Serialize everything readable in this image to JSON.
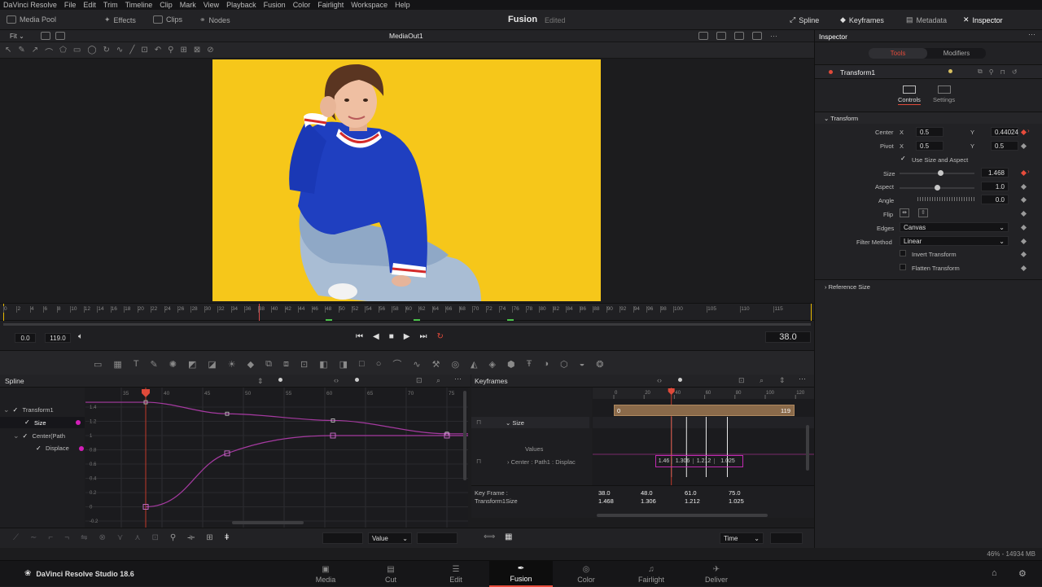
{
  "menubar": {
    "items": [
      "DaVinci Resolve",
      "File",
      "Edit",
      "Trim",
      "Timeline",
      "Clip",
      "Mark",
      "View",
      "Playback",
      "Fusion",
      "Color",
      "Fairlight",
      "Workspace",
      "Help"
    ]
  },
  "toolbar": {
    "media_pool": "Media Pool",
    "effects": "Effects",
    "clips": "Clips",
    "nodes": "Nodes",
    "title": "Fusion",
    "edited": "Edited",
    "spline": "Spline",
    "keyframes": "Keyframes",
    "metadata": "Metadata",
    "inspector": "Inspector"
  },
  "viewer": {
    "fit": "Fit",
    "name": "MediaOut1"
  },
  "ruler": {
    "ticks": [
      "0",
      "2",
      "4",
      "6",
      "8",
      "10",
      "12",
      "14",
      "16",
      "18",
      "20",
      "22",
      "24",
      "26",
      "28",
      "30",
      "32",
      "34",
      "36",
      "38",
      "40",
      "42",
      "44",
      "46",
      "48",
      "50",
      "52",
      "54",
      "56",
      "58",
      "60",
      "62",
      "64",
      "66",
      "68",
      "70",
      "72",
      "74",
      "76",
      "78",
      "80",
      "82",
      "84",
      "86",
      "88",
      "90",
      "92",
      "94",
      "96",
      "98",
      "100",
      "105",
      "110",
      "115"
    ]
  },
  "transport": {
    "start": "0.0",
    "end": "119.0",
    "current": "38.0"
  },
  "spline": {
    "title": "Spline",
    "tree": [
      {
        "label": "Transform1",
        "level": 0
      },
      {
        "label": "Size",
        "level": 1
      },
      {
        "label": "Center(Path",
        "level": 1
      },
      {
        "label": "Displace",
        "level": 2
      }
    ],
    "x_ticks": [
      "35",
      "40",
      "45",
      "50",
      "55",
      "60",
      "65",
      "70",
      "75"
    ],
    "y_ticks": [
      "1.4",
      "1.2",
      "1",
      "0.8",
      "0.6",
      "0.4",
      "0.2",
      "0",
      "-0.2"
    ],
    "value_label": "Value"
  },
  "keyframes": {
    "title": "Keyframes",
    "ticks": [
      "0",
      "20",
      "40",
      "60",
      "80",
      "100",
      "120"
    ],
    "size_label": "Size",
    "values_label": "Values",
    "center_label": "Center : Path1 : Displac",
    "range_start": "0",
    "range_end": "119",
    "key_values": [
      "1.46",
      "1.306",
      "1.212",
      "1.025"
    ],
    "kf_label": "Key Frame :",
    "kf_row_label": "Transform1Size",
    "kf_frames": [
      "38.0",
      "48.0",
      "61.0",
      "75.0"
    ],
    "kf_sizes": [
      "1.468",
      "1.306",
      "1.212",
      "1.025"
    ],
    "time_label": "Time"
  },
  "inspector": {
    "title": "Inspector",
    "tab_tools": "Tools",
    "tab_modifiers": "Modifiers",
    "node": "Transform1",
    "controls": "Controls",
    "settings": "Settings",
    "section": "Transform",
    "center_label": "Center",
    "center_x": "0.5",
    "center_y": "0.44024",
    "pivot_label": "Pivot",
    "pivot_x": "0.5",
    "pivot_y": "0.5",
    "use_size": "Use Size and Aspect",
    "size_label": "Size",
    "size_val": "1.468",
    "aspect_label": "Aspect",
    "aspect_val": "1.0",
    "angle_label": "Angle",
    "angle_val": "0.0",
    "flip_label": "Flip",
    "edges_label": "Edges",
    "edges_val": "Canvas",
    "filter_label": "Filter Method",
    "filter_val": "Linear",
    "invert": "Invert Transform",
    "flatten": "Flatten Transform",
    "reference": "Reference Size",
    "x": "X",
    "y": "Y"
  },
  "status": {
    "mem": "46% - 14934 MB"
  },
  "pagebar": {
    "product": "DaVinci Resolve Studio 18.6",
    "pages": [
      "Media",
      "Cut",
      "Edit",
      "Fusion",
      "Color",
      "Fairlight",
      "Deliver"
    ]
  }
}
